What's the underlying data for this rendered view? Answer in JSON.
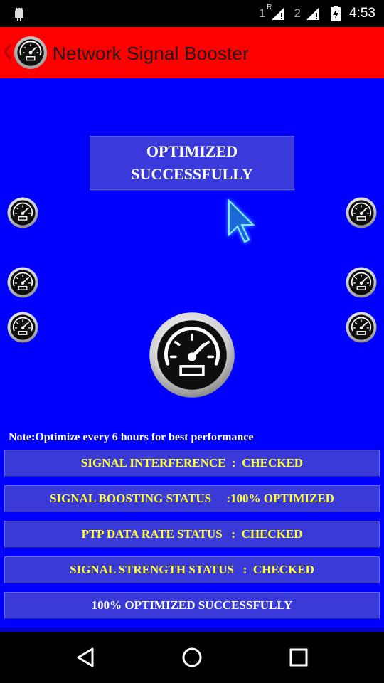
{
  "status_bar": {
    "sim1": "1",
    "sim1_flag": "R",
    "sim2": "2",
    "time": "4:53"
  },
  "app_bar": {
    "title": "Network Signal Booster"
  },
  "main": {
    "headline": "OPTIMIZED SUCCESSFULLY",
    "note": "Note:Optimize every 6 hours for best performance",
    "rows": [
      {
        "text": "SIGNAL INTERFERENCE  :  CHECKED",
        "color": "#ffff33"
      },
      {
        "text": "SIGNAL BOOSTING STATUS     :100% OPTIMIZED",
        "color": "#ffff33"
      },
      {
        "text": "PTP DATA RATE STATUS   :  CHECKED",
        "color": "#ffff33"
      },
      {
        "text": "SIGNAL STRENGTH STATUS   :  CHECKED",
        "color": "#ffff33"
      },
      {
        "text": "100% OPTIMIZED SUCCESSFULLY",
        "color": "#ffffff"
      }
    ]
  },
  "colors": {
    "app_bar_bg": "#ff0000",
    "main_bg": "#0000fe",
    "row_bg": "#3a3ad8"
  },
  "icons": {
    "gauge": "speedometer-icon",
    "cursor": "pointer-cursor-icon",
    "nav_back": "triangle-back-icon",
    "nav_home": "circle-home-icon",
    "nav_recents": "square-recents-icon"
  }
}
